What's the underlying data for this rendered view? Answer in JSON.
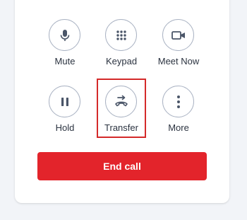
{
  "controls": {
    "mute": {
      "label": "Mute",
      "icon": "microphone-icon"
    },
    "keypad": {
      "label": "Keypad",
      "icon": "keypad-icon"
    },
    "meet_now": {
      "label": "Meet Now",
      "icon": "video-camera-icon"
    },
    "hold": {
      "label": "Hold",
      "icon": "pause-icon"
    },
    "transfer": {
      "label": "Transfer",
      "icon": "transfer-call-icon"
    },
    "more": {
      "label": "More",
      "icon": "more-vertical-icon"
    }
  },
  "end_call": {
    "label": "End call"
  },
  "colors": {
    "accent_red": "#e3242b",
    "highlight_red": "#d42a2a",
    "icon": "#4a5568",
    "circle_border": "#aab3c3",
    "text": "#2b3340",
    "background": "#f2f4f8"
  }
}
